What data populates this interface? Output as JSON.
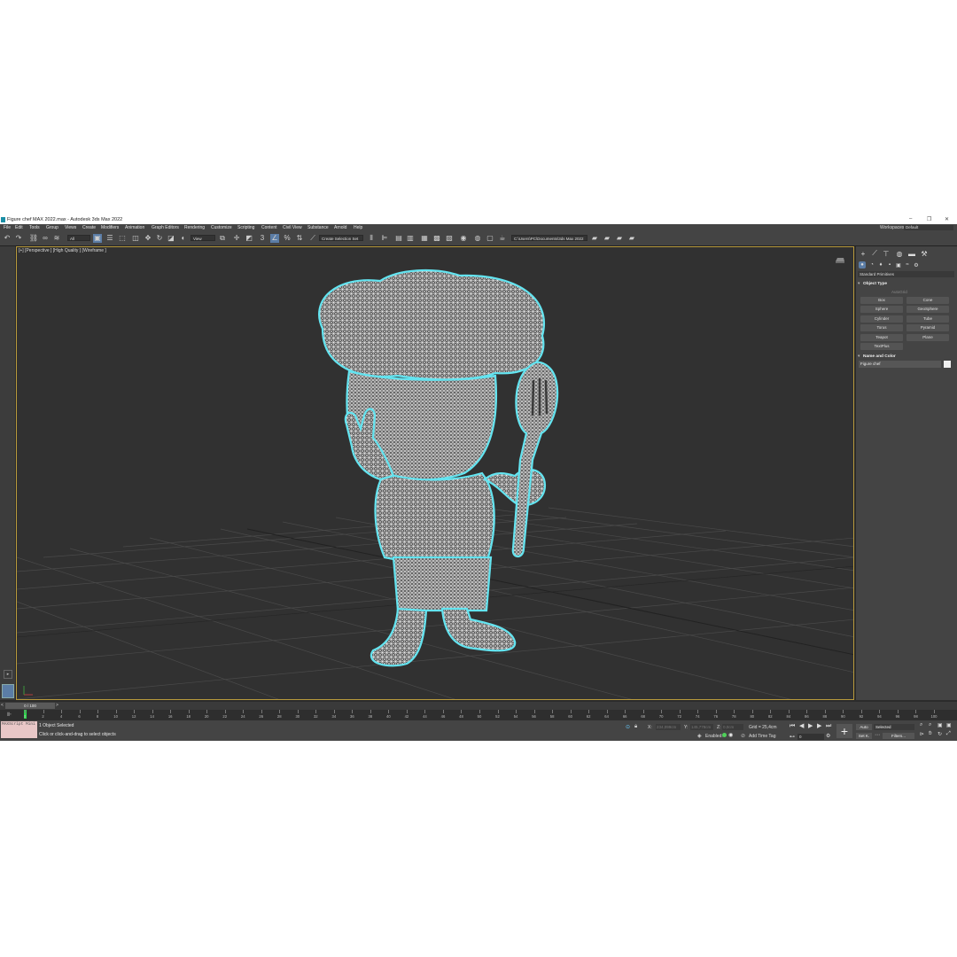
{
  "window": {
    "title": "Figure chef MAX 2022.max - Autodesk 3ds Max 2022",
    "minimize": "–",
    "restore": "❐",
    "close": "✕"
  },
  "menu": [
    "File",
    "Edit",
    "Tools",
    "Group",
    "Views",
    "Create",
    "Modifiers",
    "Animation",
    "Graph Editors",
    "Rendering",
    "Customize",
    "Scripting",
    "Content",
    "Civil View",
    "Substance",
    "Arnold",
    "Help"
  ],
  "workspaces": {
    "label": "Workspaces:",
    "value": "Default"
  },
  "toolbar": {
    "selection_filter": "All",
    "ref_coord": "View",
    "named_selection": "Create Selection Set",
    "project_path": "C:\\Users\\PC\\Documents\\3ds Max 2022"
  },
  "viewport": {
    "label": "[+] [Perspective ] [High Quality ] [Wireframe ]",
    "wire_color": "#ffffff",
    "outline_color": "#5fe3f0",
    "background": "#313131"
  },
  "command_panel": {
    "category": "Standard Primitives",
    "object_type_title": "Object Type",
    "autogrid": "AutoGrid",
    "buttons": [
      "Box",
      "Cone",
      "Sphere",
      "GeoSphere",
      "Cylinder",
      "Tube",
      "Torus",
      "Pyramid",
      "Teapot",
      "Plane",
      "TextPlus"
    ],
    "name_color_title": "Name and Color",
    "object_name": "Figure chef",
    "object_color": "#f0f0f0"
  },
  "timeline": {
    "range": "0 / 100",
    "ticks": [
      "0",
      "2",
      "4",
      "6",
      "8",
      "10",
      "12",
      "14",
      "16",
      "18",
      "20",
      "22",
      "24",
      "26",
      "28",
      "30",
      "32",
      "34",
      "36",
      "38",
      "40",
      "42",
      "44",
      "46",
      "48",
      "50",
      "52",
      "54",
      "56",
      "58",
      "60",
      "62",
      "64",
      "66",
      "68",
      "70",
      "72",
      "74",
      "76",
      "78",
      "80",
      "82",
      "84",
      "86",
      "88",
      "90",
      "92",
      "94",
      "96",
      "98",
      "100"
    ],
    "current_frame": 0
  },
  "status": {
    "maxscript": "MAXScript Mini",
    "selection": "1 Object Selected",
    "prompt": "Click or click-and-drag to select objects",
    "x_label": "X:",
    "y_label": "Y:",
    "z_label": "Z:",
    "x_value": "234,099cm",
    "y_value": "145,778cm",
    "z_value": "0,0cm",
    "grid": "Grid = 25,4cm",
    "enabled": "Enabled:",
    "add_time_tag": "Add Time Tag",
    "frame": "0",
    "auto_key": "Auto",
    "set_key": "Set K.",
    "key_filter_mode": "Selected",
    "filters": "Filters..."
  }
}
